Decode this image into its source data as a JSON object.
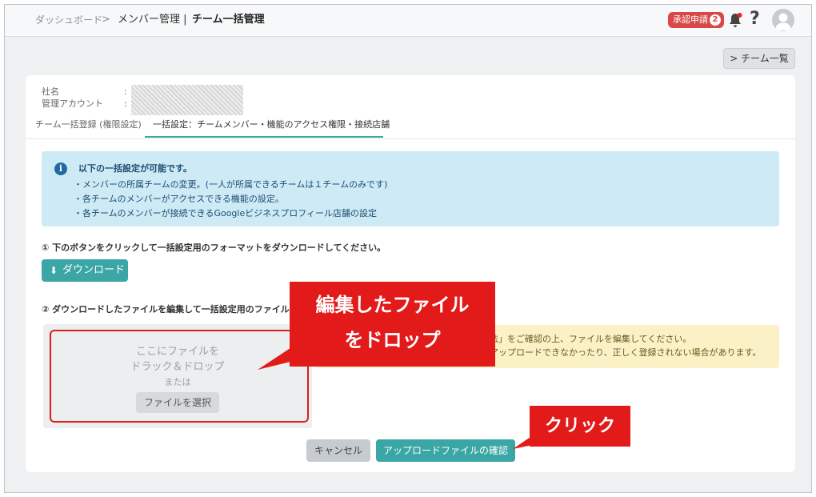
{
  "header": {
    "breadcrumb_1": "ダッシュボード",
    "breadcrumb_sep": ">",
    "breadcrumb_2": "メンバー管理 |",
    "breadcrumb_current": "チーム一括管理",
    "approval_label": "承認申請",
    "approval_count": "2",
    "help_glyph": "?"
  },
  "team_list_button": "> チーム一覧",
  "company": {
    "name_label": "社名",
    "admin_label": "管理アカウント",
    "colon": ":"
  },
  "tabs": [
    {
      "label": "チーム一括登録 (権限設定)",
      "active": false
    },
    {
      "label": "一括設定：チームメンバー・機能のアクセス権限・接続店舗",
      "active": true
    }
  ],
  "info": {
    "icon": "i",
    "title": "以下の一括設定が可能です。",
    "lines": [
      "・メンバーの所属チームの変更。(一人が所属できるチームは１チームのみです)",
      "・各チームのメンバーがアクセスできる機能の設定。",
      "・各チームのメンバーが接続できるGoogleビジネスプロフィール店舗の設定"
    ]
  },
  "step1": "① 下のボタンをクリックして一括設定用のフォーマットをダウンロードしてください。",
  "download_button": {
    "icon": "⬇",
    "label": "ダウンロード"
  },
  "step2": "② ダウンロードしたファイルを編集して一括設定用のファイルを作",
  "dropzone": {
    "line1": "ここにファイルを",
    "line2": "ドラック＆ドロップ",
    "or": "または",
    "select_button": "ファイルを選択"
  },
  "warning": {
    "line1": "法」をご確認の上、ファイルを編集してください。",
    "line2": "アップロードできなかったり、正しく登録されない場合があります。"
  },
  "buttons": {
    "cancel": "キャンセル",
    "confirm": "アップロードファイルの確認"
  },
  "callouts": {
    "drop_line1": "編集したファイル",
    "drop_line2": "をドロップ",
    "click": "クリック"
  },
  "colors": {
    "accent": "#3aa6a5",
    "callout": "#e21a1a",
    "badge": "#d94848",
    "info_bg": "#cdeaf5",
    "warning_bg": "#fbf1c7"
  }
}
